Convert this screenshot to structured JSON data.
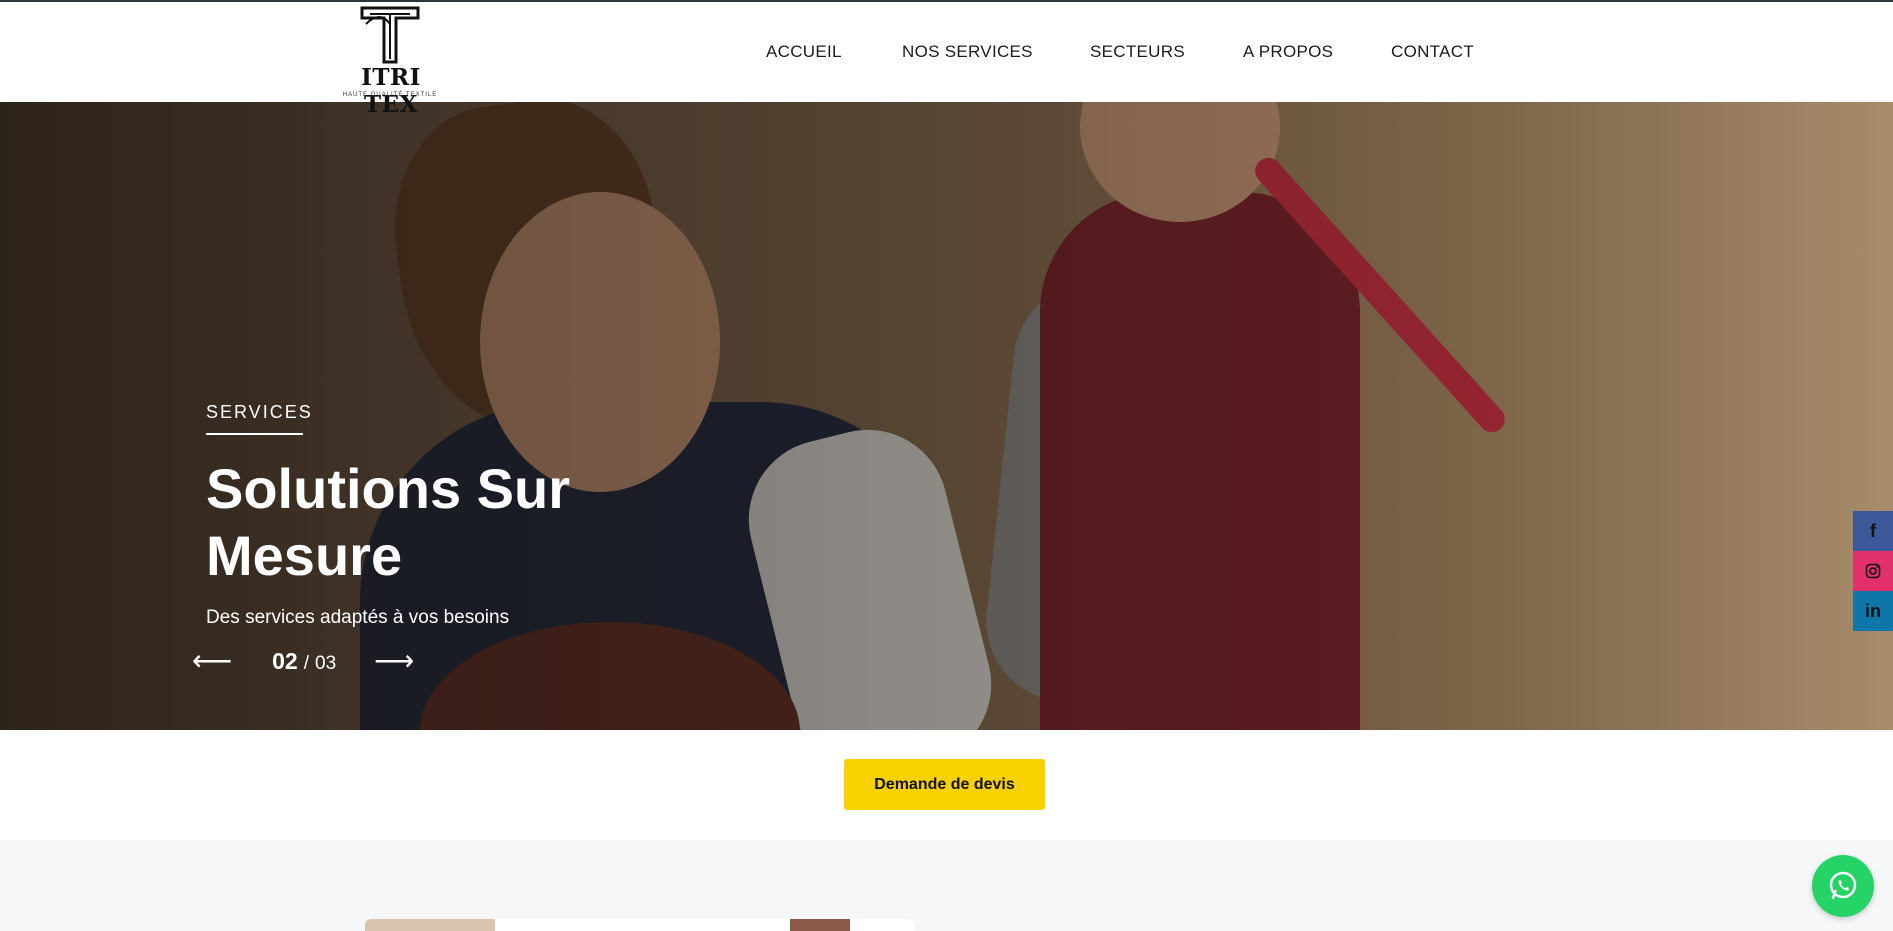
{
  "brand": {
    "name": "ITRI TEX",
    "tagline": "HAUTE QUALITÉ TEXTILE"
  },
  "nav": {
    "items": [
      {
        "label": "ACCUEIL"
      },
      {
        "label": "NOS SERVICES"
      },
      {
        "label": "SECTEURS"
      },
      {
        "label": "A PROPOS"
      },
      {
        "label": "CONTACT"
      }
    ]
  },
  "hero": {
    "eyebrow": "SERVICES",
    "title_line1": "Solutions Sur",
    "title_line2": "Mesure",
    "subtitle": "Des services adaptés à vos besoins",
    "current_slide": "02",
    "separator": "/",
    "total_slides": "03",
    "prev_icon": "arrow-left-icon",
    "next_icon": "arrow-right-icon"
  },
  "social": {
    "facebook": "f",
    "linkedin": "in"
  },
  "cta": {
    "label": "Demande de devis"
  },
  "colors": {
    "accent": "#f7d100",
    "facebook": "#3b5998",
    "instagram": "#e1306c",
    "linkedin": "#0e76a8",
    "whatsapp": "#25d366"
  }
}
